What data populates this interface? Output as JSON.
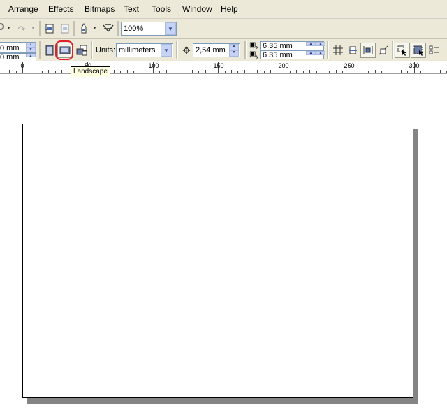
{
  "menu": {
    "arrange": {
      "mnemonic": "A",
      "rest": "rrange"
    },
    "effects": {
      "pre": "Eff",
      "mnemonic": "e",
      "rest": "cts"
    },
    "bitmaps": {
      "mnemonic": "B",
      "rest": "itmaps"
    },
    "text": {
      "mnemonic": "T",
      "rest": "ext"
    },
    "tools": {
      "pre": "T",
      "mnemonic": "o",
      "rest": "ols"
    },
    "window": {
      "mnemonic": "W",
      "rest": "indow"
    },
    "help": {
      "mnemonic": "H",
      "rest": "elp"
    }
  },
  "toolbar1": {
    "zoom_value": "100%"
  },
  "property_bar": {
    "width_value": "0 mm",
    "height_value": "0 mm",
    "units_label": "Units:",
    "units_value": "millimeters",
    "nudge_value": "2,54 mm",
    "dup_x_value": "6.35 mm",
    "dup_y_value": "6.35 mm",
    "dup_x_sub": "x",
    "dup_y_sub": "y"
  },
  "tooltip": {
    "text": "Landscape"
  },
  "ruler": {
    "labels": [
      "0",
      "50",
      "100",
      "150",
      "200",
      "250",
      "300"
    ]
  },
  "icons": {
    "portrait": "portrait-page-icon",
    "landscape": "landscape-page-icon",
    "apply_all": "apply-to-all-pages-icon",
    "nudge": "nudge-distance-icon"
  },
  "colors": {
    "highlight": "#e0202a",
    "tooltip_bg": "#ffffe1",
    "toolbar_bg": "#ece9d8"
  }
}
